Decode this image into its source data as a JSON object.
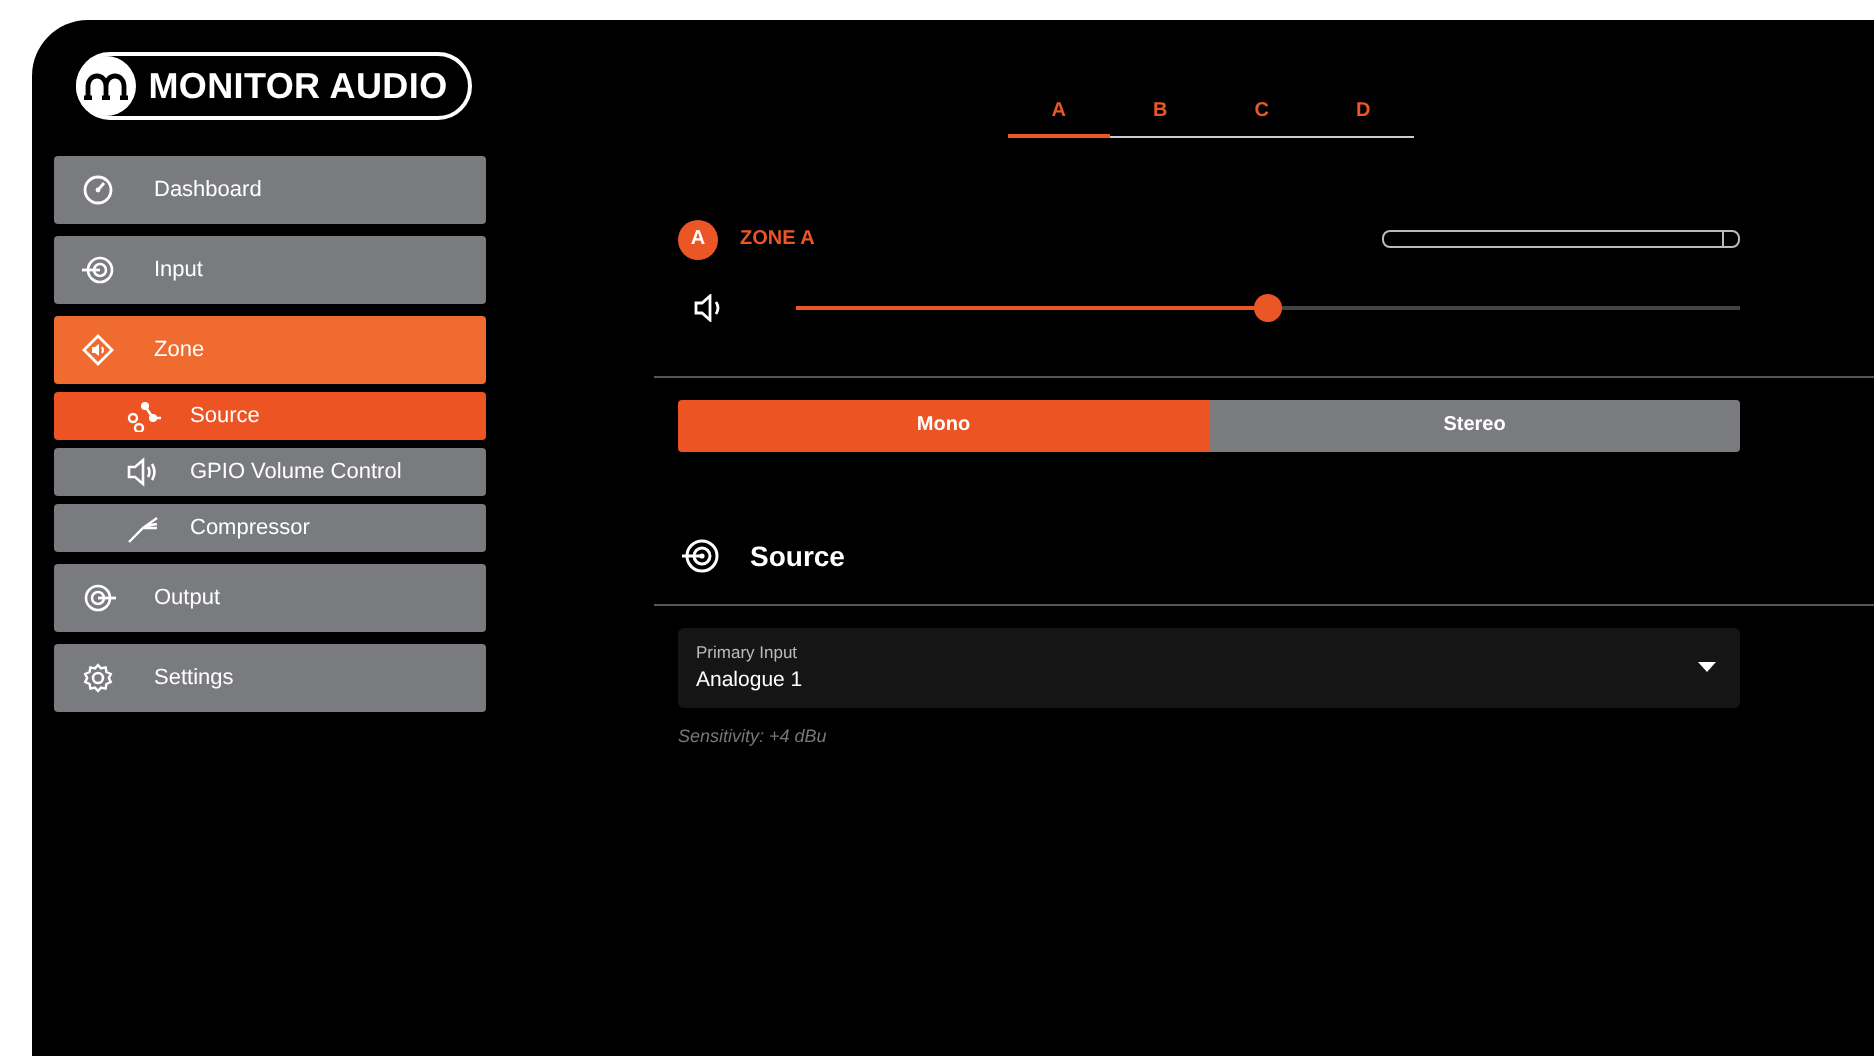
{
  "logo": {
    "text": "MONITOR AUDIO"
  },
  "nav": [
    {
      "label": "Dashboard",
      "kind": "gauge",
      "selected": false
    },
    {
      "label": "Input",
      "kind": "input",
      "selected": false
    },
    {
      "label": "Zone",
      "kind": "zone",
      "selected": true,
      "children": [
        {
          "label": "Source",
          "kind": "source",
          "selected": true
        },
        {
          "label": "GPIO Volume Control",
          "kind": "speaker",
          "selected": false
        },
        {
          "label": "Compressor",
          "kind": "compressor",
          "selected": false
        }
      ]
    },
    {
      "label": "Output",
      "kind": "output",
      "selected": false
    },
    {
      "label": "Settings",
      "kind": "gear",
      "selected": false
    }
  ],
  "zone_tabs": [
    {
      "label": "A",
      "selected": true
    },
    {
      "label": "B",
      "selected": false
    },
    {
      "label": "C",
      "selected": false
    },
    {
      "label": "D",
      "selected": false
    }
  ],
  "zone": {
    "badge": "A",
    "name": "ZONE A",
    "volume": {
      "level": 0.5
    }
  },
  "mode": [
    {
      "label": "Mono",
      "selected": true
    },
    {
      "label": "Stereo",
      "selected": false
    }
  ],
  "section": {
    "title": "Source"
  },
  "primary_input": {
    "label": "Primary Input",
    "value": "Analogue 1"
  },
  "note": "Sensitivity: +4 dBu"
}
